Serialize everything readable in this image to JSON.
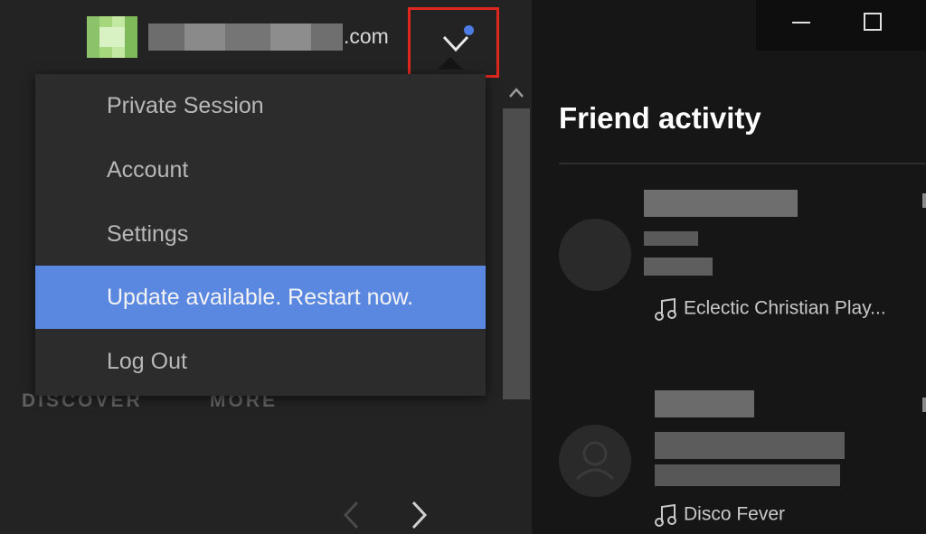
{
  "account": {
    "email_domain": ".com"
  },
  "menu": {
    "items": [
      {
        "label": "Private Session",
        "highlight": false
      },
      {
        "label": "Account",
        "highlight": false
      },
      {
        "label": "Settings",
        "highlight": false
      },
      {
        "label": "Update available. Restart now.",
        "highlight": true
      },
      {
        "label": "Log Out",
        "highlight": false
      }
    ]
  },
  "nav": {
    "discover_label": "DISCOVER",
    "more_label": "MORE"
  },
  "friend_activity": {
    "title": "Friend activity",
    "friends": [
      {
        "track": "Eclectic Christian Play..."
      },
      {
        "track": "Disco Fever"
      }
    ]
  },
  "icons": {
    "dropdown": "chevron-down-icon",
    "notification": "notification-dot-icon",
    "minimize": "minimize-icon",
    "maximize": "maximize-icon",
    "scroll_up": "chevron-up-icon",
    "back": "chevron-left-icon",
    "forward": "chevron-right-icon",
    "music_note": "music-note-icon",
    "user": "user-icon"
  },
  "colors": {
    "highlight": "#5a87e0",
    "notification_dot": "#4e7be5",
    "annotation_box": "#e0271f"
  }
}
